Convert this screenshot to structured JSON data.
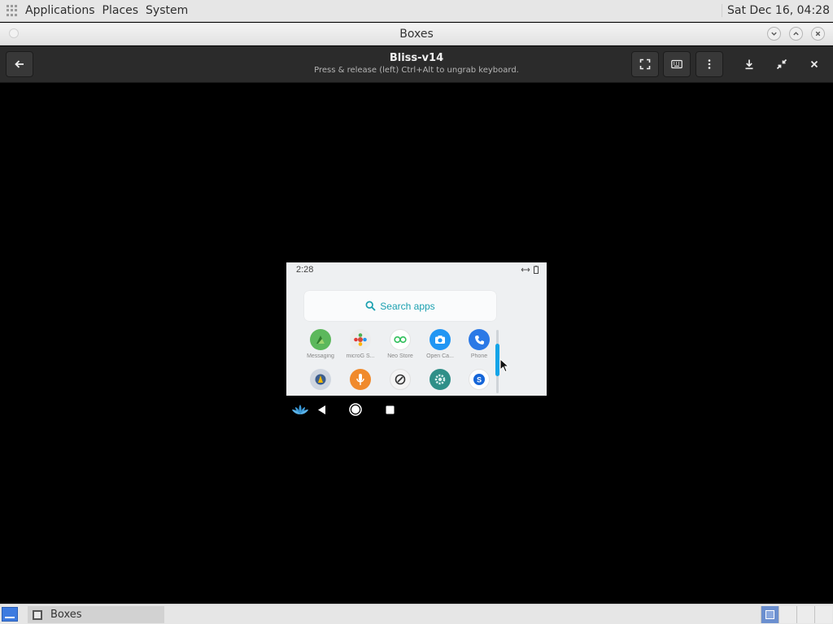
{
  "top_panel": {
    "menus": [
      "Applications",
      "Places",
      "System"
    ],
    "clock": "Sat Dec 16, 04:28"
  },
  "window": {
    "title": "Boxes"
  },
  "header": {
    "vm_name": "Bliss-v14",
    "hint": "Press & release (left) Ctrl+Alt to ungrab keyboard."
  },
  "android": {
    "status_time": "2:28",
    "search_placeholder": "Search apps",
    "apps_row1": [
      {
        "label": "Messaging",
        "color": "#5cb85c",
        "icon": "messaging-icon"
      },
      {
        "label": "microG S...",
        "color": "#ececec",
        "icon": "microg-icon"
      },
      {
        "label": "Neo Store",
        "color": "#ffffff",
        "icon": "neo-store-icon"
      },
      {
        "label": "Open Ca...",
        "color": "#2196f3",
        "icon": "camera-icon"
      },
      {
        "label": "Phone",
        "color": "#2b79e6",
        "icon": "phone-icon"
      }
    ],
    "apps_row2": [
      {
        "label": "",
        "color": "#3c5e8e",
        "icon": "app-icon"
      },
      {
        "label": "",
        "color": "#f08a2c",
        "icon": "recorder-icon"
      },
      {
        "label": "",
        "color": "#f4f4f4",
        "icon": "rotate-icon"
      },
      {
        "label": "",
        "color": "#2f8f88",
        "icon": "settings-icon"
      },
      {
        "label": "",
        "color": "#ffffff",
        "icon": "s-app-icon"
      }
    ]
  },
  "taskbar": {
    "task_label": "Boxes"
  },
  "colors": {
    "accent": "#13a4e8",
    "search_text": "#1aa0b0"
  }
}
